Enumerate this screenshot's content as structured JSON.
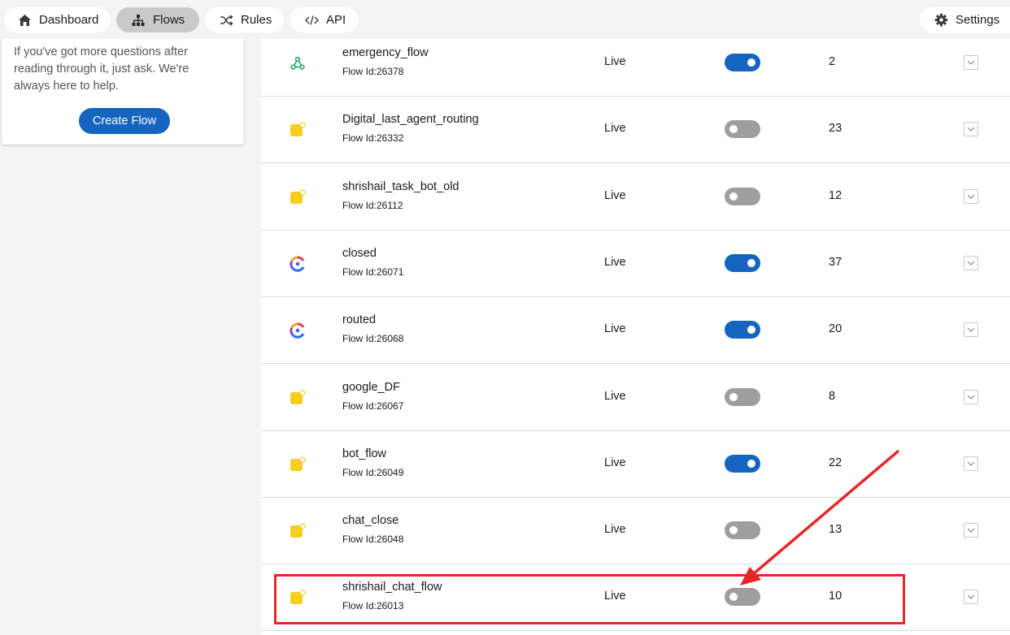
{
  "nav": {
    "dashboard_label": "Dashboard",
    "flows_label": "Flows",
    "rules_label": "Rules",
    "api_label": "API",
    "settings_label": "Settings",
    "active": "Flows"
  },
  "help": {
    "text": "If you've got more questions after reading through it, just ask. We're always here to help.",
    "create_flow_label": "Create Flow"
  },
  "flows": [
    {
      "name": "emergency_flow",
      "flow_id": "Flow Id:26378",
      "status": "Live",
      "enabled": true,
      "count": "2",
      "icon": "webhook-icon"
    },
    {
      "name": "Digital_last_agent_routing",
      "flow_id": "Flow Id:26332",
      "status": "Live",
      "enabled": false,
      "count": "23",
      "icon": "yellow-note-icon"
    },
    {
      "name": "shrishail_task_bot_old",
      "flow_id": "Flow Id:26112",
      "status": "Live",
      "enabled": false,
      "count": "12",
      "icon": "yellow-note-icon"
    },
    {
      "name": "closed",
      "flow_id": "Flow Id:26071",
      "status": "Live",
      "enabled": true,
      "count": "37",
      "icon": "colorful-c-logo-icon"
    },
    {
      "name": "routed",
      "flow_id": "Flow Id:26068",
      "status": "Live",
      "enabled": true,
      "count": "20",
      "icon": "colorful-c-logo-icon"
    },
    {
      "name": "google_DF",
      "flow_id": "Flow Id:26067",
      "status": "Live",
      "enabled": false,
      "count": "8",
      "icon": "yellow-note-icon"
    },
    {
      "name": "bot_flow",
      "flow_id": "Flow Id:26049",
      "status": "Live",
      "enabled": true,
      "count": "22",
      "icon": "yellow-note-icon"
    },
    {
      "name": "chat_close",
      "flow_id": "Flow Id:26048",
      "status": "Live",
      "enabled": false,
      "count": "13",
      "icon": "yellow-note-icon"
    },
    {
      "name": "shrishail_chat_flow",
      "flow_id": "Flow Id:26013",
      "status": "Live",
      "enabled": false,
      "count": "10",
      "icon": "yellow-note-icon"
    }
  ],
  "annotation": {
    "highlighted_flow": "shrishail_chat_flow",
    "color": "#e3282a"
  },
  "colors": {
    "accent": "#1565c0",
    "toggle_off": "#9e9e9e"
  }
}
